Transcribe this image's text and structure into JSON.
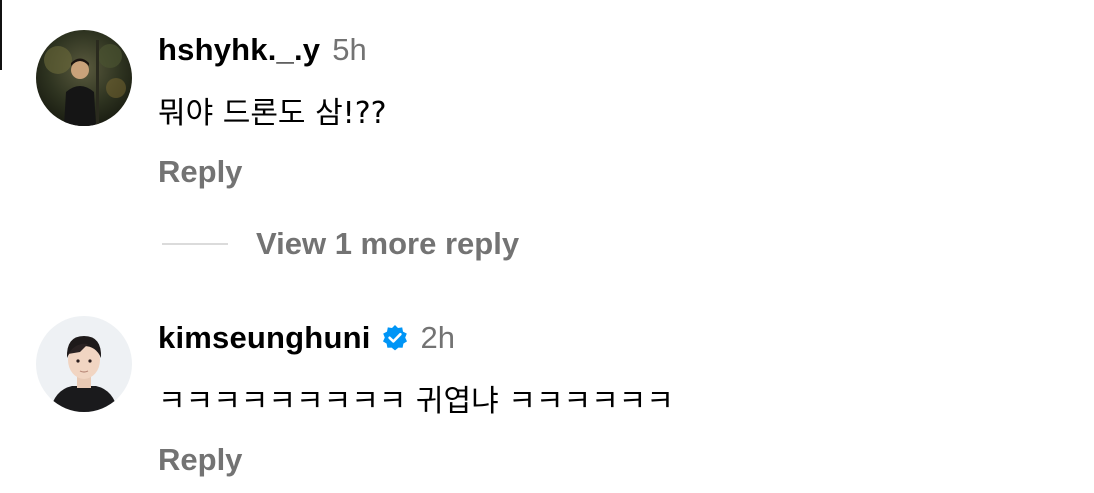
{
  "colors": {
    "primary_text": "#000000",
    "secondary_text": "#737373",
    "divider": "#dbdbdb",
    "verified": "#0095f6"
  },
  "comments": [
    {
      "username": "hshyhk._.y",
      "time": "5h",
      "text": "뭐야 드론도 삼!??",
      "reply_label": "Reply",
      "verified": false,
      "avatar_icon": "user-avatar-photo"
    },
    {
      "username": "kimseunghuni",
      "time": "2h",
      "text": "ㅋㅋㅋㅋㅋㅋㅋㅋㅋ 귀엽냐 ㅋㅋㅋㅋㅋㅋ",
      "reply_label": "Reply",
      "verified": true,
      "avatar_icon": "user-avatar-photo"
    }
  ],
  "view_more_replies": "View 1 more reply"
}
